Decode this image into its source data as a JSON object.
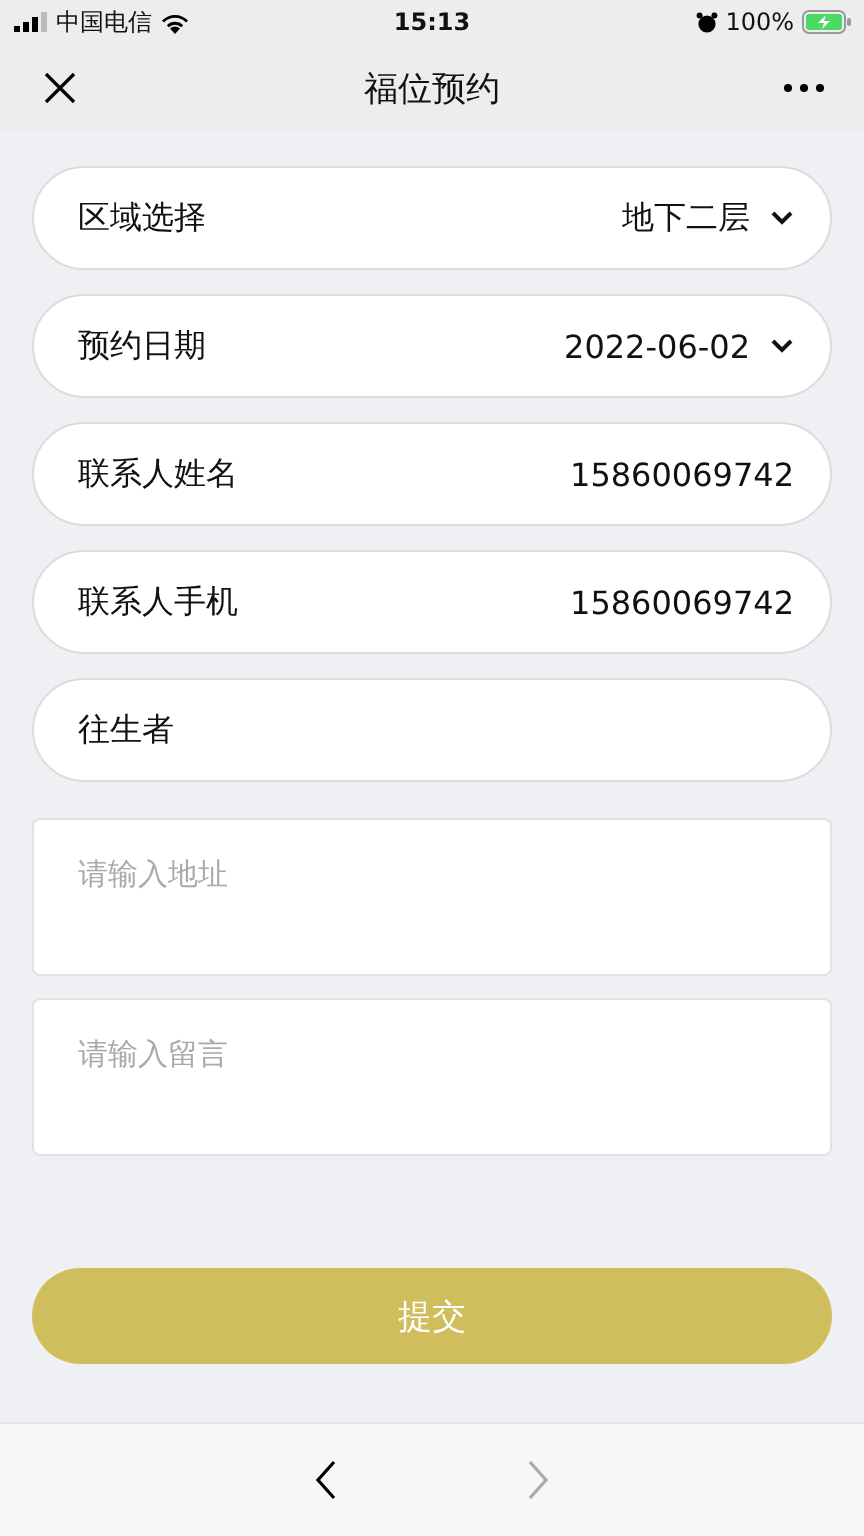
{
  "status_bar": {
    "carrier": "中国电信",
    "time": "15:13",
    "battery": "100%"
  },
  "nav_bar": {
    "title": "福位预约"
  },
  "fields": [
    {
      "kind": "select",
      "label": "区域选择",
      "value": "地下二层"
    },
    {
      "kind": "select",
      "label": "预约日期",
      "value": "2022-06-02"
    },
    {
      "kind": "text",
      "label": "联系人姓名",
      "value": "15860069742"
    },
    {
      "kind": "text",
      "label": "联系人手机",
      "value": "15860069742"
    },
    {
      "kind": "text",
      "label": "往生者"
    }
  ],
  "text_areas": [
    {
      "placeholder": "请输入地址"
    },
    {
      "placeholder": "请输入留言"
    }
  ],
  "submit_button": {
    "label": "提交"
  },
  "bottom_nav": [
    {
      "kind": "back",
      "disabled": false
    },
    {
      "kind": "forward",
      "disabled": true
    }
  ]
}
